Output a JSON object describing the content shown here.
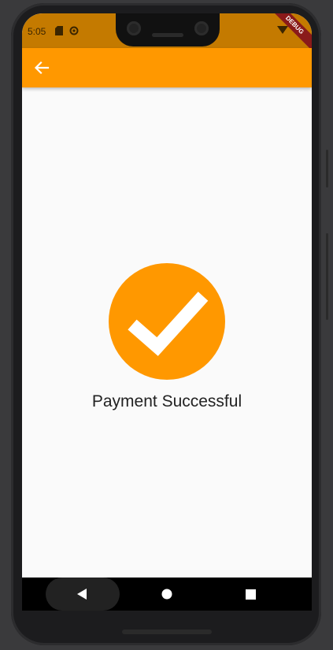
{
  "status_bar": {
    "time": "5:05",
    "icons": [
      "sd-card-icon",
      "sync-icon",
      "wifi-icon",
      "battery-icon"
    ],
    "debug_banner": "DEBUG",
    "background": "#c47a00"
  },
  "app_bar": {
    "back_icon": "arrow-left-icon",
    "background": "#ff9800"
  },
  "main": {
    "status_icon": "check-circle-icon",
    "message": "Payment Successful",
    "accent": "#ff9800"
  },
  "nav_bar": {
    "buttons": [
      "back-triangle-icon",
      "home-circle-icon",
      "recents-square-icon"
    ]
  }
}
